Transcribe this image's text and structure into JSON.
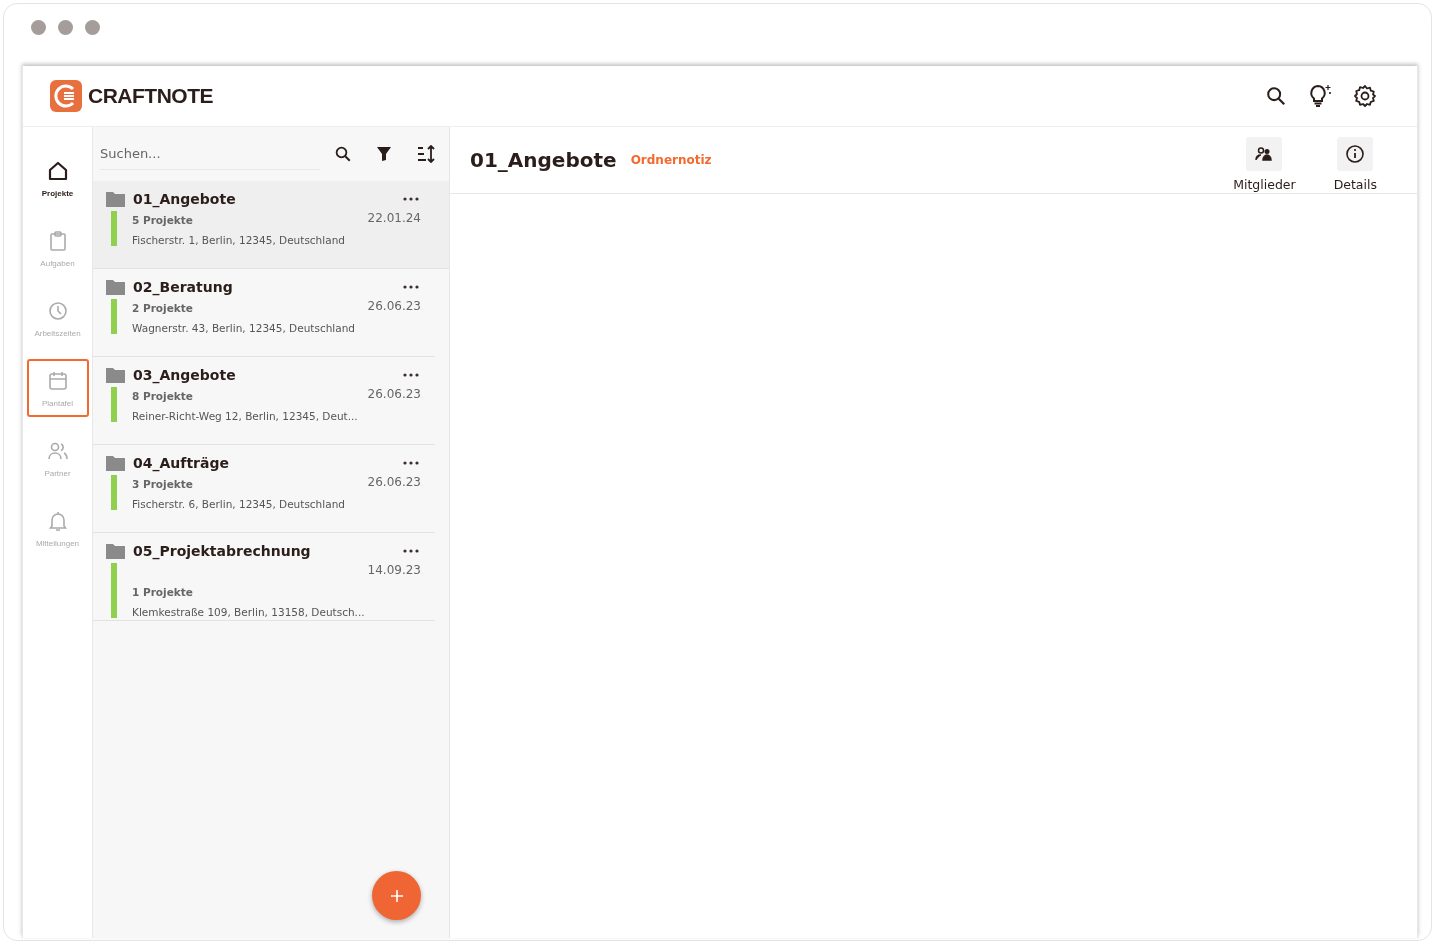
{
  "app": {
    "logo": "CRAFTNOTE"
  },
  "nav": [
    {
      "label": "Projekte",
      "kind": "home",
      "selected": true,
      "highlighted": false
    },
    {
      "label": "Aufgaben",
      "kind": "clipboard",
      "selected": false,
      "highlighted": false
    },
    {
      "label": "Arbeitszeiten",
      "kind": "clock",
      "selected": false,
      "highlighted": false
    },
    {
      "label": "Plantafel",
      "kind": "calendar",
      "selected": false,
      "highlighted": true
    },
    {
      "label": "Partner",
      "kind": "people",
      "selected": false,
      "highlighted": false
    },
    {
      "label": "Mitteilungen",
      "kind": "bell",
      "selected": false,
      "highlighted": false
    }
  ],
  "search": {
    "placeholder": "Suchen..."
  },
  "folders": [
    {
      "name": "01_Angebote",
      "count": "5 Projekte",
      "date": "22.01.24",
      "address": "Fischerstr. 1, Berlin, 12345, Deutschland",
      "color": "#8fd14f",
      "selected": true,
      "date_first": false
    },
    {
      "name": "02_Beratung",
      "count": "2 Projekte",
      "date": "26.06.23",
      "address": "Wagnerstr. 43, Berlin, 12345, Deutschland",
      "color": "#8fd14f",
      "selected": false,
      "date_first": false
    },
    {
      "name": "03_Angebote",
      "count": "8 Projekte",
      "date": "26.06.23",
      "address": "Reiner-Richt-Weg 12, Berlin, 12345, Deut...",
      "color": "#8fd14f",
      "selected": false,
      "date_first": false
    },
    {
      "name": "04_Aufträge",
      "count": "3 Projekte",
      "date": "26.06.23",
      "address": "Fischerstr. 6, Berlin, 12345, Deutschland",
      "color": "#8fd14f",
      "selected": false,
      "date_first": false
    },
    {
      "name": "05_Projektabrechnung",
      "count": "1 Projekte",
      "date": "14.09.23",
      "address": "Klemkestraße 109, Berlin, 13158, Deutsch...",
      "color": "#8fd14f",
      "selected": false,
      "date_first": true
    }
  ],
  "detail": {
    "title": "01_Angebote",
    "note_link": "Ordnernotiz",
    "actions": [
      {
        "label": "Mitglieder",
        "kind": "members"
      },
      {
        "label": "Details",
        "kind": "info"
      }
    ]
  }
}
